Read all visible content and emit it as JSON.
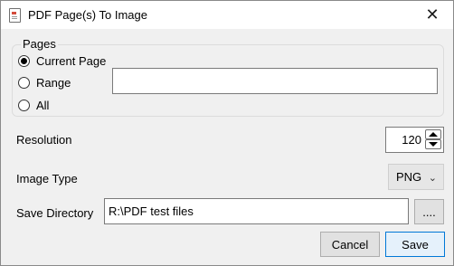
{
  "window": {
    "title": "PDF Page(s) To Image",
    "icon": "pdf-document-icon",
    "close_glyph": "✕"
  },
  "pages": {
    "group_title": "Pages",
    "options": [
      {
        "label": "Current Page",
        "checked": true
      },
      {
        "label": "Range",
        "checked": false
      },
      {
        "label": "All",
        "checked": false
      }
    ],
    "range_value": ""
  },
  "resolution": {
    "label": "Resolution",
    "value": "120"
  },
  "image_type": {
    "label": "Image Type",
    "selected": "PNG",
    "chevron": "⌄"
  },
  "save_directory": {
    "label": "Save Directory",
    "value": "R:\\PDF test files",
    "browse_label": "...."
  },
  "buttons": {
    "cancel": "Cancel",
    "save": "Save"
  },
  "colors": {
    "dialog_background": "#f0f0f0",
    "default_button_border": "#0078d7",
    "default_button_fill": "#e5f1fb"
  }
}
